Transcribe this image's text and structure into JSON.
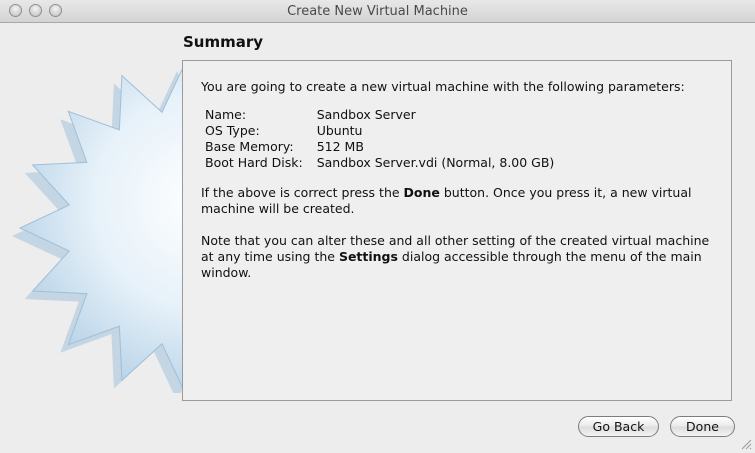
{
  "window": {
    "title": "Create New Virtual Machine"
  },
  "page": {
    "heading": "Summary"
  },
  "summary": {
    "intro": "You are going to create a new virtual machine with the following parameters:",
    "params": [
      {
        "label": "Name:",
        "value": "Sandbox Server"
      },
      {
        "label": "OS Type:",
        "value": "Ubuntu"
      },
      {
        "label": "Base Memory:",
        "value": "512 MB"
      },
      {
        "label": "Boot Hard Disk:",
        "value": "Sandbox Server.vdi (Normal, 8.00 GB)"
      }
    ],
    "confirm_pre": "If the above is correct press the ",
    "confirm_bold": "Done",
    "confirm_post": " button. Once you press it, a new virtual machine will be created.",
    "note_pre": "Note that you can alter these and all other setting of the created virtual machine at any time using the ",
    "note_bold": "Settings",
    "note_post": " dialog accessible through the menu of the main window."
  },
  "buttons": {
    "back": "Go Back",
    "done": "Done"
  }
}
